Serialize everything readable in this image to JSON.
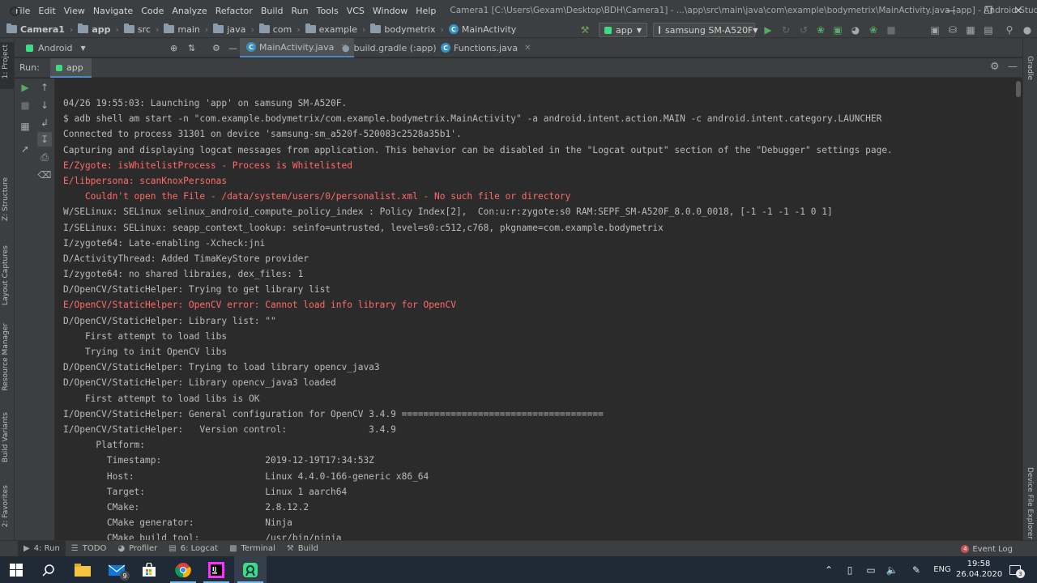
{
  "menu": [
    "File",
    "Edit",
    "View",
    "Navigate",
    "Code",
    "Analyze",
    "Refactor",
    "Build",
    "Run",
    "Tools",
    "VCS",
    "Window",
    "Help"
  ],
  "window_title": "Camera1 [C:\\Users\\Gexam\\Desktop\\BDH\\Camera1] - ...\\app\\src\\main\\java\\com\\example\\bodymetrix\\MainActivity.java [app] - Android Studio",
  "breadcrumbs": [
    "Camera1",
    "app",
    "src",
    "main",
    "java",
    "com",
    "example",
    "bodymetrix",
    "MainActivity"
  ],
  "toolbar": {
    "run_config": "app",
    "device": "samsung SM-A520F"
  },
  "project_view": "Android",
  "editor_tabs": [
    "MainActivity.java",
    "build.gradle (:app)",
    "Functions.java"
  ],
  "left_stripe": [
    "1: Project",
    "Z: Structure",
    "Layout Captures",
    "Resource Manager",
    "Build Variants",
    "2: Favorites"
  ],
  "right_stripe": [
    "Gradle",
    "Device File Explorer"
  ],
  "run_panel": {
    "label": "Run:",
    "tab": "app"
  },
  "console": [
    {
      "text": "04/26 19:55:03: Launching 'app' on samsung SM-A520F.",
      "level": "info"
    },
    {
      "text": "$ adb shell am start -n \"com.example.bodymetrix/com.example.bodymetrix.MainActivity\" -a android.intent.action.MAIN -c android.intent.category.LAUNCHER",
      "level": "info"
    },
    {
      "text": "Connected to process 31301 on device 'samsung-sm_a520f-520083c2528a35b1'.",
      "level": "info"
    },
    {
      "text": "Capturing and displaying logcat messages from application. This behavior can be disabled in the \"Logcat output\" section of the \"Debugger\" settings page.",
      "level": "info"
    },
    {
      "text": "E/Zygote: isWhitelistProcess - Process is Whitelisted",
      "level": "error"
    },
    {
      "text": "E/libpersona: scanKnoxPersonas",
      "level": "error"
    },
    {
      "text": "    Couldn't open the File - /data/system/users/0/personalist.xml - No such file or directory",
      "level": "error"
    },
    {
      "text": "W/SELinux: SELinux selinux_android_compute_policy_index : Policy Index[2],  Con:u:r:zygote:s0 RAM:SEPF_SM-A520F_8.0.0_0018, [-1 -1 -1 -1 0 1]",
      "level": "info"
    },
    {
      "text": "I/SELinux: SELinux: seapp_context_lookup: seinfo=untrusted, level=s0:c512,c768, pkgname=com.example.bodymetrix",
      "level": "info"
    },
    {
      "text": "I/zygote64: Late-enabling -Xcheck:jni",
      "level": "info"
    },
    {
      "text": "D/ActivityThread: Added TimaKeyStore provider",
      "level": "info"
    },
    {
      "text": "I/zygote64: no shared libraies, dex_files: 1",
      "level": "info"
    },
    {
      "text": "D/OpenCV/StaticHelper: Trying to get library list",
      "level": "info"
    },
    {
      "text": "E/OpenCV/StaticHelper: OpenCV error: Cannot load info library for OpenCV",
      "level": "error"
    },
    {
      "text": "D/OpenCV/StaticHelper: Library list: \"\"",
      "level": "info"
    },
    {
      "text": "    First attempt to load libs",
      "level": "info"
    },
    {
      "text": "    Trying to init OpenCV libs",
      "level": "info"
    },
    {
      "text": "D/OpenCV/StaticHelper: Trying to load library opencv_java3",
      "level": "info"
    },
    {
      "text": "D/OpenCV/StaticHelper: Library opencv_java3 loaded",
      "level": "info"
    },
    {
      "text": "    First attempt to load libs is OK",
      "level": "info"
    },
    {
      "text": "I/OpenCV/StaticHelper: General configuration for OpenCV 3.4.9 =====================================",
      "level": "info"
    },
    {
      "text": "I/OpenCV/StaticHelper:   Version control:               3.4.9",
      "level": "info"
    },
    {
      "text": "      Platform:",
      "level": "info"
    },
    {
      "text": "        Timestamp:                   2019-12-19T17:34:53Z",
      "level": "info"
    },
    {
      "text": "        Host:                        Linux 4.4.0-166-generic x86_64",
      "level": "info"
    },
    {
      "text": "        Target:                      Linux 1 aarch64",
      "level": "info"
    },
    {
      "text": "        CMake:                       2.8.12.2",
      "level": "info"
    },
    {
      "text": "        CMake generator:             Ninja",
      "level": "info"
    },
    {
      "text": "        CMake build tool:            /usr/bin/ninja",
      "level": "info"
    }
  ],
  "bottom_tabs": [
    "4: Run",
    "TODO",
    "Profiler",
    "6: Logcat",
    "Terminal",
    "Build"
  ],
  "event_log": {
    "label": "Event Log",
    "count": "4"
  },
  "taskbar": {
    "mail_badge": "9",
    "language": "ENG",
    "time": "19:58",
    "date": "26.04.2020",
    "notification_count": "3"
  },
  "colors": {
    "accent": "#4a88c7",
    "error_text": "#ff6b68",
    "android_green": "#3ddc84"
  }
}
